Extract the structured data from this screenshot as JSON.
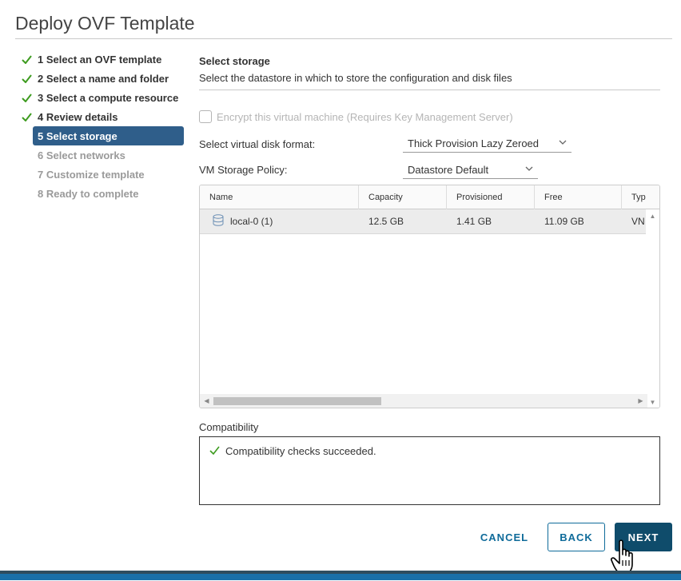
{
  "dialog": {
    "title": "Deploy OVF Template"
  },
  "steps": [
    {
      "label": "1 Select an OVF template",
      "state": "done"
    },
    {
      "label": "2 Select a name and folder",
      "state": "done"
    },
    {
      "label": "3 Select a compute resource",
      "state": "done"
    },
    {
      "label": "4 Review details",
      "state": "done"
    },
    {
      "label": "5 Select storage",
      "state": "active"
    },
    {
      "label": "6 Select networks",
      "state": "pending"
    },
    {
      "label": "7 Customize template",
      "state": "pending"
    },
    {
      "label": "8 Ready to complete",
      "state": "pending"
    }
  ],
  "storage": {
    "heading": "Select storage",
    "description": "Select the datastore in which to store the configuration and disk files",
    "encrypt_label": "Encrypt this virtual machine (Requires Key Management Server)",
    "disk_format_label": "Select virtual disk format:",
    "disk_format_value": "Thick Provision Lazy Zeroed",
    "policy_label": "VM Storage Policy:",
    "policy_value": "Datastore Default"
  },
  "grid": {
    "columns": [
      "Name",
      "Capacity",
      "Provisioned",
      "Free",
      "Typ"
    ],
    "rows": [
      {
        "name": "local-0 (1)",
        "capacity": "12.5 GB",
        "provisioned": "1.41 GB",
        "free": "11.09 GB",
        "type": "VN"
      }
    ],
    "hscroll_fraction": 0.4
  },
  "compatibility": {
    "label": "Compatibility",
    "message": "Compatibility checks succeeded."
  },
  "buttons": {
    "cancel": "CANCEL",
    "back": "BACK",
    "next": "NEXT"
  },
  "colors": {
    "active_step": "#2f5e8a",
    "check_green": "#3d9b1f",
    "primary_button": "#0f4c6b",
    "link_blue": "#0f6b9a"
  },
  "icons": {
    "done_step": "check-icon",
    "datastore": "database-icon"
  }
}
